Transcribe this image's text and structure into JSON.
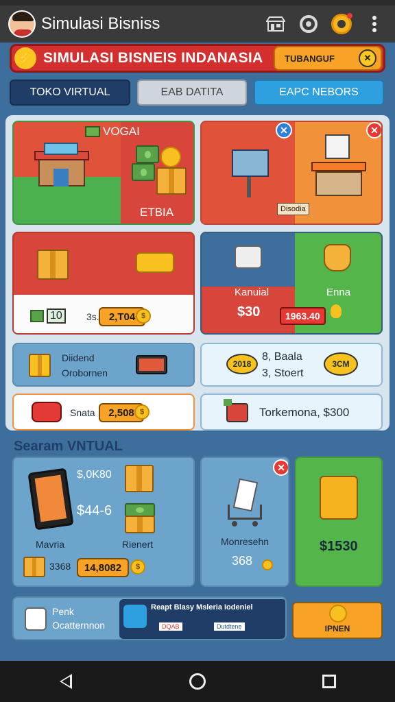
{
  "app": {
    "title": "Simulasi Bisniss",
    "icons": [
      "avatar-icon",
      "store-icon",
      "chat-icon",
      "coin-icon",
      "more-vertical-icon"
    ]
  },
  "banner": {
    "title": "SIMULASI BISNEIS INDANASIA",
    "button_label": "TUBANGUF",
    "button_icon": "wrench-icon"
  },
  "tabs": [
    {
      "label": "TOKO VIRTUAL"
    },
    {
      "label": "EAB DATITA"
    },
    {
      "label": "EAPC NEBORS"
    }
  ],
  "cards": {
    "shop_main": {
      "badge": "VOGAI",
      "price": "ETBIA"
    },
    "store_right": {
      "tag": "Disodia"
    },
    "goods": {
      "left_value": "10",
      "price_label": "3s.",
      "price": "2,T04"
    },
    "kanual": {
      "label": "Kanuial",
      "price": "$30",
      "price_tag": "1963.40",
      "hand_label": "Enna"
    },
    "dividend": {
      "line1": "Diidend",
      "line2": "Orobornen"
    },
    "deals": {
      "badge_left": "2018",
      "line1": "8, Baala",
      "line2": "3, Stoert",
      "badge_right": "3CM"
    },
    "snata": {
      "label": "Snata",
      "value": "2,508"
    },
    "torkemono": {
      "text": "Torkemona, $300"
    }
  },
  "section": {
    "title": "Searam VNTUAL"
  },
  "lower": {
    "device": {
      "price_top": "$,0K80",
      "price_mid": "$44-6",
      "label_left": "Mavria",
      "label_right": "Rienert",
      "count": "3368",
      "value": "14,8082"
    },
    "cart": {
      "label": "Monresehn",
      "value": "368"
    },
    "green": {
      "price": "$1530"
    },
    "footer": {
      "label_line1": "Penk",
      "label_line2": "Ocatternnon",
      "info_title": "Reapt Blasy Msleria Iodeniel",
      "chip1": "DQAB",
      "chip2": "Dutdtene",
      "button": "IPNEN"
    }
  },
  "colors": {
    "accent": "#f8a326",
    "banner": "#d32f2f",
    "panel": "#d8e5ef",
    "background": "#3e6e9c"
  }
}
